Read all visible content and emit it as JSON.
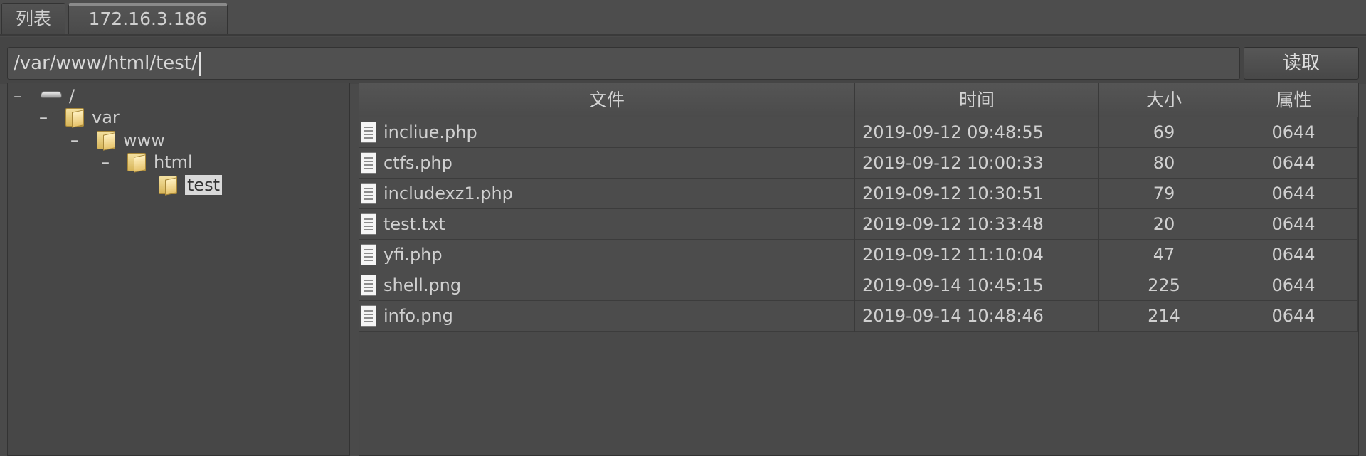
{
  "tabs": [
    {
      "label": "列表"
    },
    {
      "label": "172.16.3.186"
    }
  ],
  "pathbar": {
    "path_value": "/var/www/html/test/",
    "read_button": "读取"
  },
  "tree": {
    "nodes": [
      {
        "label": "/",
        "expander": "–",
        "icon": "drive-icon"
      },
      {
        "label": "var",
        "expander": "–",
        "icon": "folder-icon"
      },
      {
        "label": "www",
        "expander": "–",
        "icon": "folder-icon"
      },
      {
        "label": "html",
        "expander": "–",
        "icon": "folder-icon"
      },
      {
        "label": "test",
        "expander": "",
        "icon": "folder-icon",
        "selected": true
      }
    ]
  },
  "table": {
    "columns": {
      "name": "文件",
      "time": "时间",
      "size": "大小",
      "attr": "属性"
    },
    "rows": [
      {
        "name": "incliue.php",
        "time": "2019-09-12 09:48:55",
        "size": "69",
        "attr": "0644"
      },
      {
        "name": "ctfs.php",
        "time": "2019-09-12 10:00:33",
        "size": "80",
        "attr": "0644"
      },
      {
        "name": "includexz1.php",
        "time": "2019-09-12 10:30:51",
        "size": "79",
        "attr": "0644"
      },
      {
        "name": "test.txt",
        "time": "2019-09-12 10:33:48",
        "size": "20",
        "attr": "0644"
      },
      {
        "name": "yfi.php",
        "time": "2019-09-12 11:10:04",
        "size": "47",
        "attr": "0644"
      },
      {
        "name": "shell.png",
        "time": "2019-09-14 10:45:15",
        "size": "225",
        "attr": "0644"
      },
      {
        "name": "info.png",
        "time": "2019-09-14 10:48:46",
        "size": "214",
        "attr": "0644"
      }
    ]
  },
  "colors": {
    "background": "#4a4a4a",
    "text": "#d0d0d0",
    "selection": "#d9d9d9",
    "folder": "#e6c36c"
  }
}
